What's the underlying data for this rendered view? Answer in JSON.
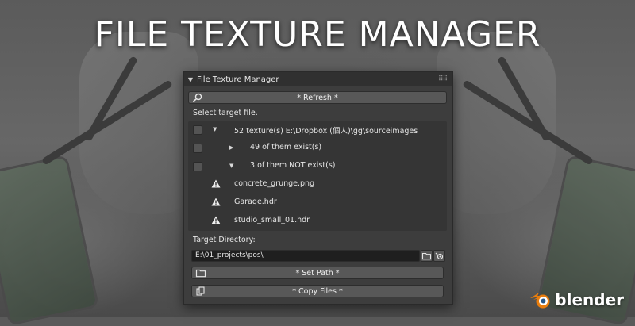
{
  "banner": {
    "title": "FILE TEXTURE MANAGER"
  },
  "panel": {
    "title": "File Texture Manager",
    "refresh_label": "*  Refresh  *",
    "select_label": "Select target file.",
    "tree": {
      "root": "52 texture(s)  E:\\Dropbox (個人)\\gg\\sourceimages",
      "exist": "49 of them exist(s)",
      "not_exist": "3 of them NOT exist(s)",
      "missing_files": [
        "concrete_grunge.png",
        "Garage.hdr",
        "studio_small_01.hdr"
      ]
    },
    "target_dir_label": "Target Directory:",
    "target_dir_value": "E:\\01_projects\\pos\\",
    "set_path_label": "*  Set Path  *",
    "copy_files_label": "*  Copy Files  *"
  },
  "logo": {
    "text": "blender"
  },
  "colors": {
    "accent": "#e87d0d",
    "blue": "#265787",
    "panel_bg": "#3d3d3d"
  }
}
